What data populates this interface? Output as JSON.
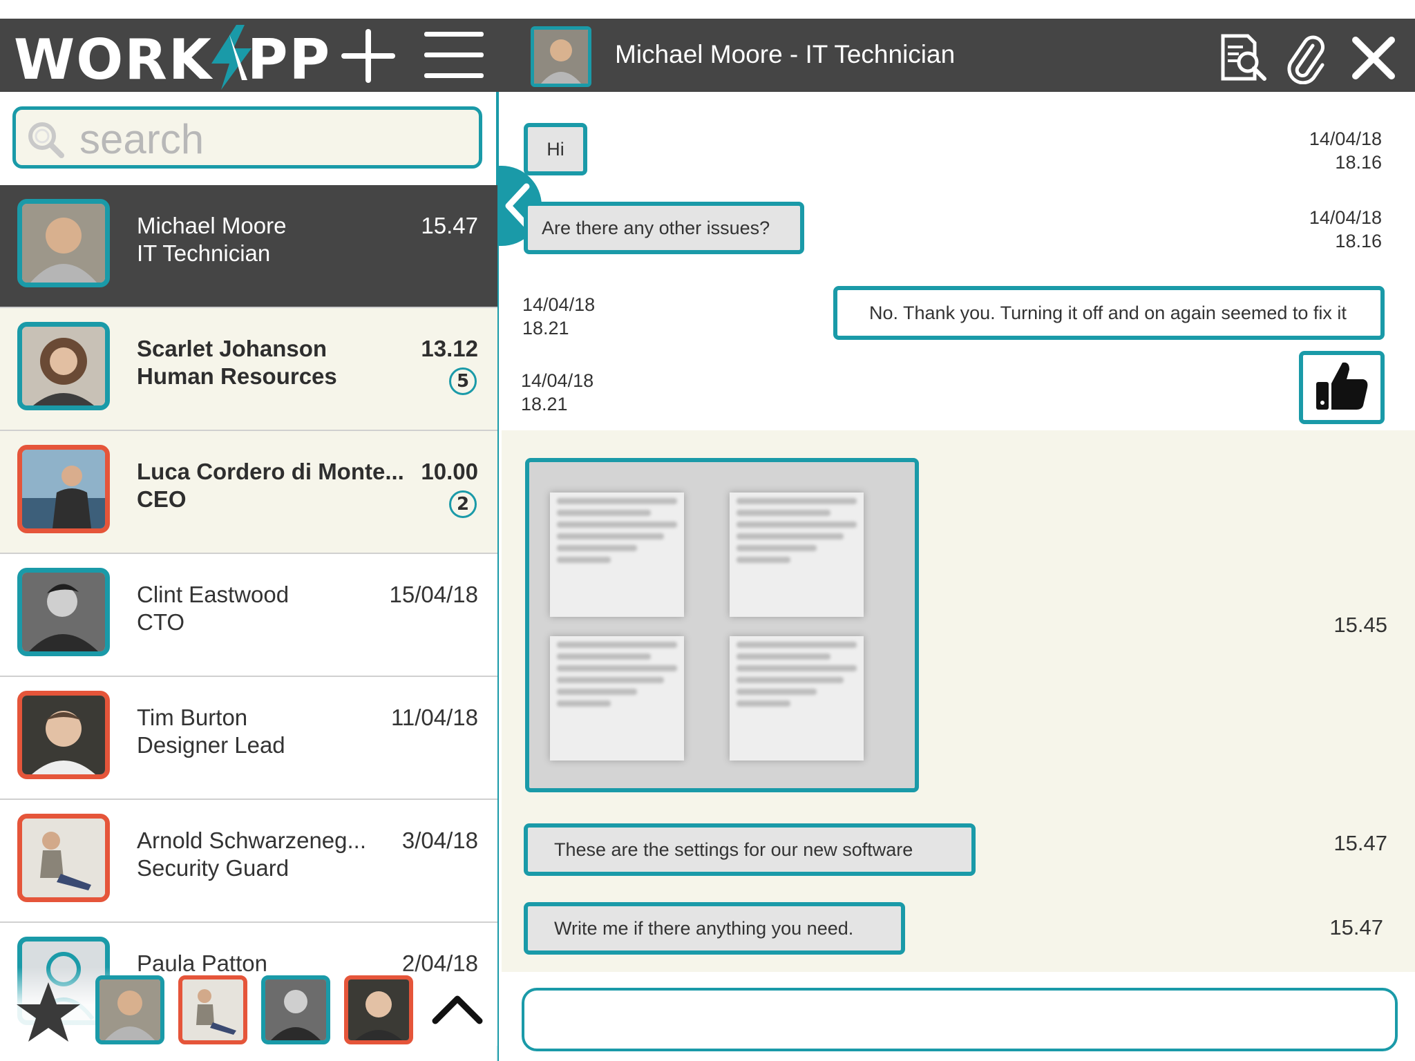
{
  "app": {
    "logo_left": "WORK",
    "logo_right": "PP",
    "accent": "#1a9aa8",
    "alert": "#e5553a",
    "dark": "#454545",
    "cream": "#f6f5ea"
  },
  "toolbar": {
    "add_icon": "plus-icon",
    "menu_icon": "hamburger-menu-icon"
  },
  "header": {
    "title": "Michael Moore - IT Technician",
    "actions": [
      "search-document-icon",
      "paperclip-icon",
      "close-icon"
    ]
  },
  "search": {
    "placeholder": "search",
    "value": ""
  },
  "contacts": [
    {
      "name": "Michael Moore",
      "role": "IT Technician",
      "time": "15.47",
      "state": "active",
      "border": "teal"
    },
    {
      "name": "Scarlet Johanson",
      "role": "Human Resources",
      "time": "13.12",
      "unread": "5",
      "state": "unread",
      "border": "teal"
    },
    {
      "name": "Luca Cordero di Monte...",
      "role": "CEO",
      "time": "10.00",
      "unread": "2",
      "state": "unread",
      "border": "red"
    },
    {
      "name": "Clint Eastwood",
      "role": "CTO",
      "time": "15/04/18",
      "state": "read",
      "border": "teal"
    },
    {
      "name": "Tim Burton",
      "role": "Designer Lead",
      "time": "11/04/18",
      "state": "read",
      "border": "red"
    },
    {
      "name": "Arnold Schwarzeneg...",
      "role": "Security Guard",
      "time": "3/04/18",
      "state": "read",
      "border": "red"
    },
    {
      "name": "Paula Patton",
      "role": "",
      "time": "2/04/18",
      "state": "read",
      "border": "teal"
    }
  ],
  "favorites": {
    "star_icon": "star-icon",
    "expand_icon": "chevron-up-icon",
    "people": [
      "Michael Moore",
      "Arnold Schwarzeneg...",
      "Clint Eastwood",
      "Tim Burton"
    ]
  },
  "messages": [
    {
      "text": "Hi",
      "direction": "in",
      "date": "14/04/18",
      "time": "18.16"
    },
    {
      "text": "Are there any other issues?",
      "direction": "in",
      "date": "14/04/18",
      "time": "18.16"
    },
    {
      "text": "No. Thank you. Turning it off and on again seemed to fix it",
      "direction": "out",
      "date": "14/04/18",
      "time": "18.21"
    },
    {
      "icon": "thumbs-up-icon",
      "direction": "out",
      "date": "14/04/18",
      "time": "18.21"
    },
    {
      "attachment": "image",
      "direction": "in",
      "time": "15.45"
    },
    {
      "text": "These are the settings for our new software",
      "direction": "in",
      "time": "15.47"
    },
    {
      "text": "Write me if there anything you need.",
      "direction": "in",
      "time": "15.47"
    }
  ],
  "compose": {
    "value": ""
  }
}
